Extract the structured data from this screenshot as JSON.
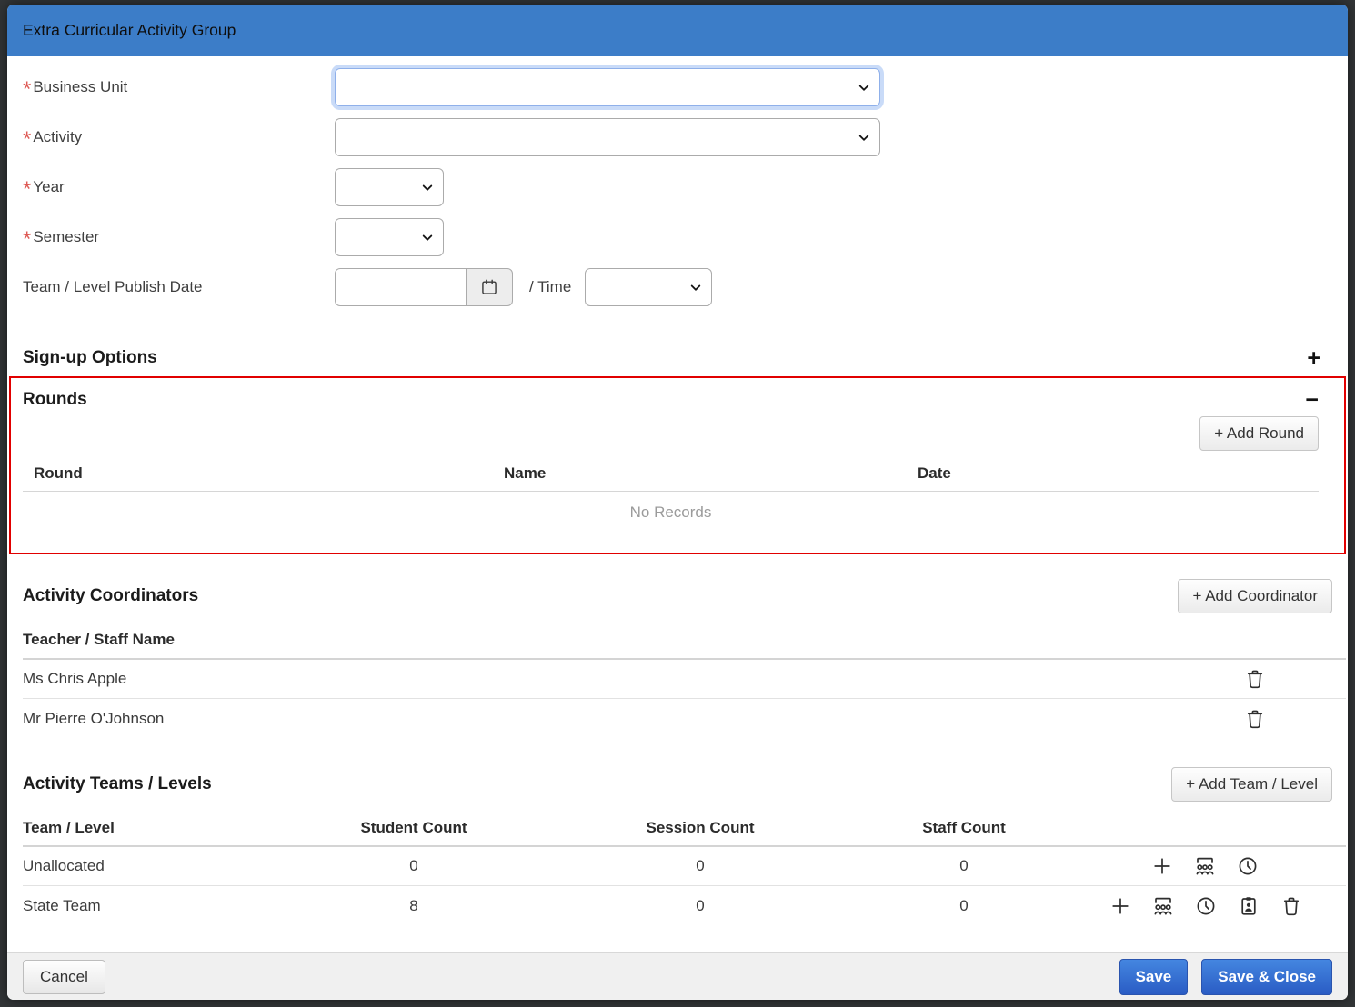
{
  "modal": {
    "title": "Extra Curricular Activity Group"
  },
  "form": {
    "required_marker": "*",
    "business_unit": {
      "label": "Business Unit",
      "required": true,
      "value": ""
    },
    "activity": {
      "label": "Activity",
      "required": true,
      "value": ""
    },
    "year": {
      "label": "Year",
      "required": true,
      "value": ""
    },
    "semester": {
      "label": "Semester",
      "required": true,
      "value": ""
    },
    "publish_date": {
      "label": "Team / Level Publish Date",
      "value": "",
      "time_label": "/ Time",
      "time_value": ""
    }
  },
  "signup_options": {
    "title": "Sign-up Options",
    "toggle_icon": "+"
  },
  "rounds": {
    "title": "Rounds",
    "toggle_icon": "−",
    "add_button": "+ Add Round",
    "columns": {
      "round": "Round",
      "name": "Name",
      "date": "Date"
    },
    "empty_text": "No Records"
  },
  "coordinators": {
    "title": "Activity Coordinators",
    "add_button": "+ Add Coordinator",
    "column_header": "Teacher / Staff Name",
    "rows": [
      {
        "name": "Ms Chris Apple"
      },
      {
        "name": "Mr Pierre O'Johnson"
      }
    ]
  },
  "teams": {
    "title": "Activity Teams / Levels",
    "add_button": "+ Add Team / Level",
    "columns": {
      "team": "Team / Level",
      "student": "Student Count",
      "session": "Session Count",
      "staff": "Staff Count"
    },
    "rows": [
      {
        "name": "Unallocated",
        "student": "0",
        "session": "0",
        "staff": "0"
      },
      {
        "name": "State Team",
        "student": "8",
        "session": "0",
        "staff": "0"
      }
    ]
  },
  "footer": {
    "cancel": "Cancel",
    "save": "Save",
    "save_close": "Save & Close"
  },
  "colors": {
    "header_blue": "#3c7dc8",
    "rounds_highlight_border": "#e10000",
    "primary_button_blue": "#2f63c9",
    "required_asterisk_red": "#de5a55",
    "backdrop": "#323537"
  },
  "icons": {
    "calendar": "calendar-icon",
    "chevron": "chevron-down-icon",
    "plus": "plus-icon",
    "minus": "minus-icon",
    "group": "group-icon",
    "clock": "clock-icon",
    "clipboard_person": "clipboard-person-icon",
    "trash": "trash-icon"
  }
}
